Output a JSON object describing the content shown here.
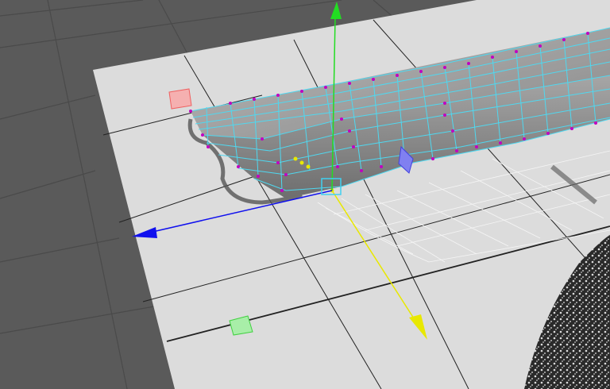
{
  "viewport": {
    "background_color": "#5a5a5a",
    "plane_color": "#dcdcdc",
    "grid_color": "#1e1e1e",
    "wire_color": "#4fd8f0",
    "vertex_color": "#c000c0",
    "mesh_color": "#9a9a9a"
  },
  "manipulator": {
    "y_axis_color": "#22dd22",
    "z_axis_color": "#e8e800",
    "x_axis_color": "#1010ee",
    "center_handle_color": "#40d0f0",
    "xy_plane_handle_color": "#f06060",
    "yz_plane_handle_color": "#40d040",
    "xz_plane_handle_color": "#4040e0"
  }
}
